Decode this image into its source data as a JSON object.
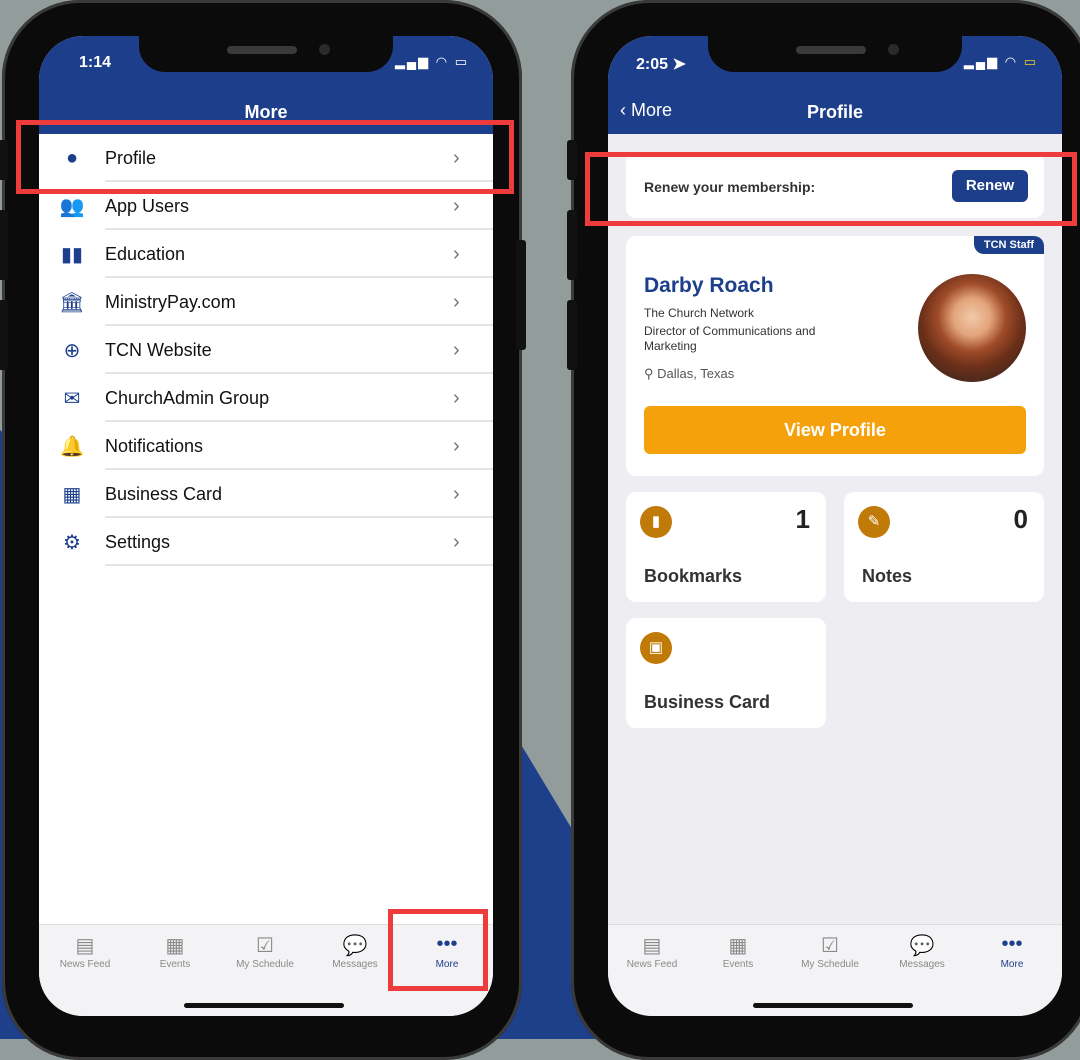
{
  "left_phone": {
    "status": {
      "time": "1:14",
      "icons": "signal-wifi-battery"
    },
    "navbar_title": "More",
    "menu": [
      {
        "label": "Profile",
        "icon": "user-circle-icon",
        "glyph": "●"
      },
      {
        "label": "App Users",
        "icon": "users-icon",
        "glyph": "👥"
      },
      {
        "label": "Education",
        "icon": "book-icon",
        "glyph": "▮▮"
      },
      {
        "label": "MinistryPay.com",
        "icon": "bank-icon",
        "glyph": "🏛"
      },
      {
        "label": "TCN Website",
        "icon": "globe-icon",
        "glyph": "⊕"
      },
      {
        "label": "ChurchAdmin Group",
        "icon": "mail-icon",
        "glyph": "✉"
      },
      {
        "label": "Notifications",
        "icon": "bell-icon",
        "glyph": "🔔"
      },
      {
        "label": "Business Card",
        "icon": "qr-code-icon",
        "glyph": "▦"
      },
      {
        "label": "Settings",
        "icon": "gear-icon",
        "glyph": "⚙"
      }
    ],
    "chevron": "›",
    "tabs": [
      {
        "label": "News Feed",
        "icon": "newspaper-icon",
        "glyph": "▤"
      },
      {
        "label": "Events",
        "icon": "calendar-icon",
        "glyph": "▦"
      },
      {
        "label": "My Schedule",
        "icon": "calendar-check-icon",
        "glyph": "☑"
      },
      {
        "label": "Messages",
        "icon": "chat-icon",
        "glyph": "💬"
      },
      {
        "label": "More",
        "icon": "more-dots-icon",
        "glyph": "•••"
      }
    ]
  },
  "right_phone": {
    "status": {
      "time": "2:05 ➤",
      "icons": "signal-wifi-battery-charging"
    },
    "navbar_title": "Profile",
    "back_label": "More",
    "back_glyph": "‹",
    "renew": {
      "label": "Renew your membership:",
      "button": "Renew"
    },
    "profile": {
      "badge": "TCN Staff",
      "name": "Darby Roach",
      "org": "The Church Network",
      "title": "Director of Communications and Marketing",
      "location": "Dallas, Texas",
      "pin_glyph": "⚲",
      "button": "View Profile"
    },
    "stats": [
      {
        "label": "Bookmarks",
        "count": "1",
        "icon": "bookmark-icon",
        "glyph": "▮"
      },
      {
        "label": "Notes",
        "count": "0",
        "icon": "note-edit-icon",
        "glyph": "✎"
      },
      {
        "label": "Business Card",
        "count": "",
        "icon": "id-card-icon",
        "glyph": "▣"
      }
    ],
    "tabs": [
      {
        "label": "News Feed",
        "icon": "newspaper-icon",
        "glyph": "▤"
      },
      {
        "label": "Events",
        "icon": "calendar-icon",
        "glyph": "▦"
      },
      {
        "label": "My Schedule",
        "icon": "calendar-check-icon",
        "glyph": "☑"
      },
      {
        "label": "Messages",
        "icon": "chat-icon",
        "glyph": "💬"
      },
      {
        "label": "More",
        "icon": "more-dots-icon",
        "glyph": "•••"
      }
    ]
  },
  "colors": {
    "brand": "#1d3f8b",
    "accent": "#f4a10b",
    "highlight": "#ee3b3b",
    "stat_icon": "#c07a07"
  }
}
